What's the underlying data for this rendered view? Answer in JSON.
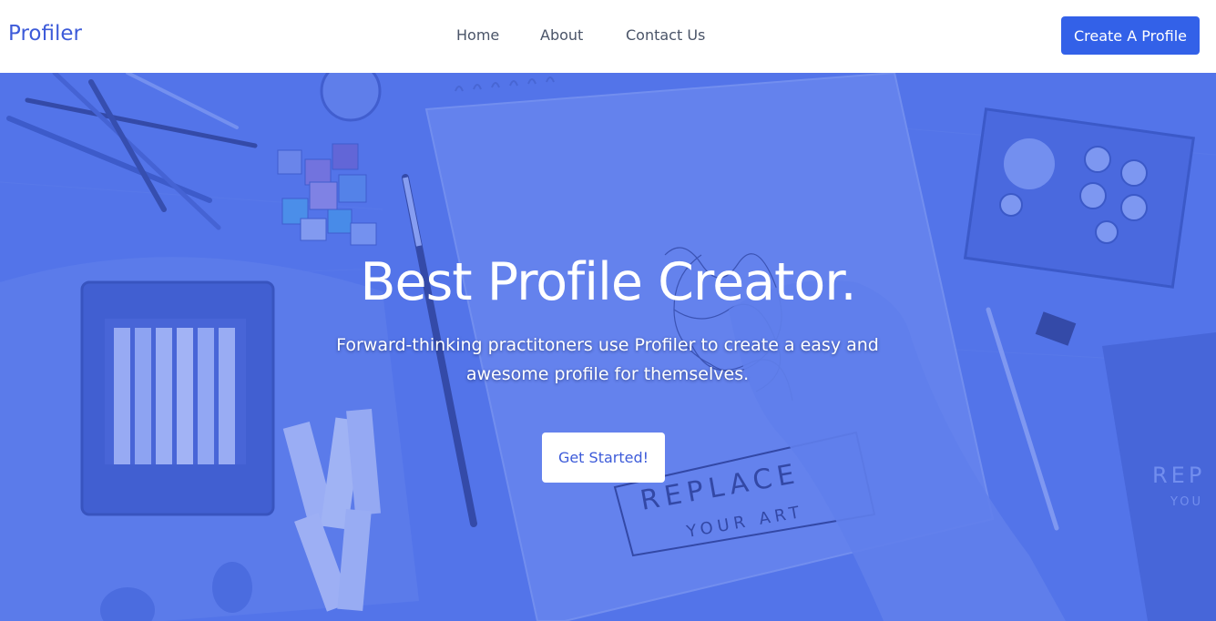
{
  "nav": {
    "brand": "Profiler",
    "links": [
      {
        "label": "Home"
      },
      {
        "label": "About"
      },
      {
        "label": "Contact Us"
      }
    ],
    "cta_label": "Create A Profile"
  },
  "hero": {
    "title": "Best Profile Creator.",
    "subtitle": "Forward-thinking practitoners use Profiler to create a easy and awesome profile for themselves.",
    "button_label": "Get Started!",
    "background_art_text": [
      "REPLACE",
      "YOUR ART"
    ],
    "overlay_color": "#4a6ce8"
  },
  "colors": {
    "brand": "#3d5bd9",
    "primary_button": "#3361e8",
    "nav_text": "#4a5468",
    "hero_bg": "#5a79e6"
  }
}
